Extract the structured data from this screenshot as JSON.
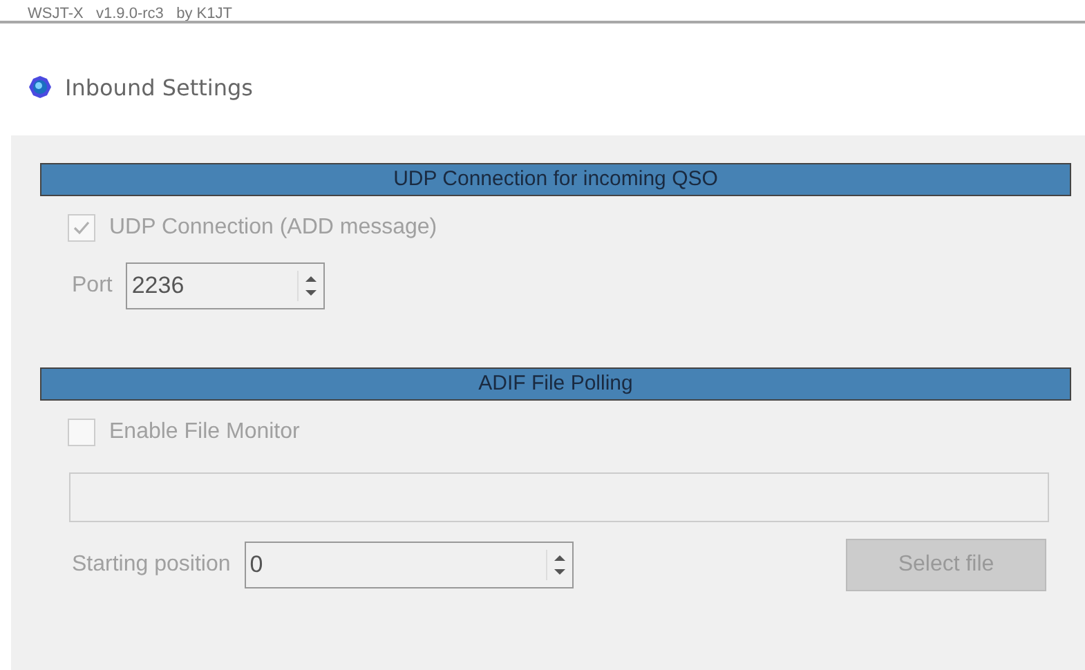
{
  "parent_window": {
    "title": "WSJT-X   v1.9.0-rc3   by K1JT"
  },
  "dialog": {
    "title": "Inbound Settings"
  },
  "sections": [
    {
      "header": "UDP Connection for incoming QSO",
      "disabled": true,
      "checkbox": {
        "label": "UDP Connection (ADD message)",
        "checked": true
      },
      "spinner": {
        "label": "Port",
        "value": "2236"
      }
    },
    {
      "header": "ADIF File Polling",
      "disabled": true,
      "checkbox": {
        "label": "Enable File Monitor",
        "checked": false
      },
      "path_field": true,
      "spinner": {
        "label": "Starting position",
        "value": "0"
      },
      "button": "Select file"
    }
  ]
}
